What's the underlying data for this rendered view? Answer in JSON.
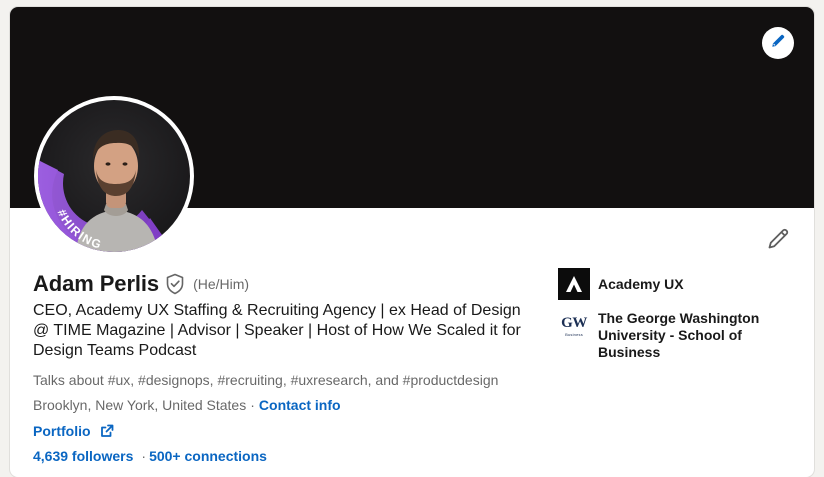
{
  "profile": {
    "name": "Adam Perlis",
    "pronouns": "(He/Him)",
    "headline": "CEO, Academy UX Staffing & Recruiting Agency | ex Head of Design @ TIME Magazine | Advisor | Speaker | Host of How We Scaled it for Design Teams Podcast",
    "talks_about": "Talks about #ux, #designops, #recruiting, #uxresearch, and #productdesign",
    "location": "Brooklyn, New York, United States",
    "separator": "·",
    "contact_info": "Contact info",
    "portfolio": "Portfolio",
    "followers": "4,639 followers",
    "connections": "500+ connections",
    "hiring_frame_text": "#HIRING"
  },
  "experience": [
    {
      "name": "Academy UX",
      "logo": "academy-ux-logo"
    },
    {
      "name": "The George Washington University - School of Business",
      "logo": "gw-logo",
      "logo_text": "GW",
      "logo_subtext": "Business"
    }
  ],
  "icons": {
    "cover_edit": "pencil-icon",
    "profile_edit": "pencil-icon",
    "verified": "shield-check-icon",
    "external_link": "external-link-icon"
  },
  "colors": {
    "link": "#0a66c2",
    "cover": "#121010",
    "hiring_frame": "#8344cc"
  }
}
